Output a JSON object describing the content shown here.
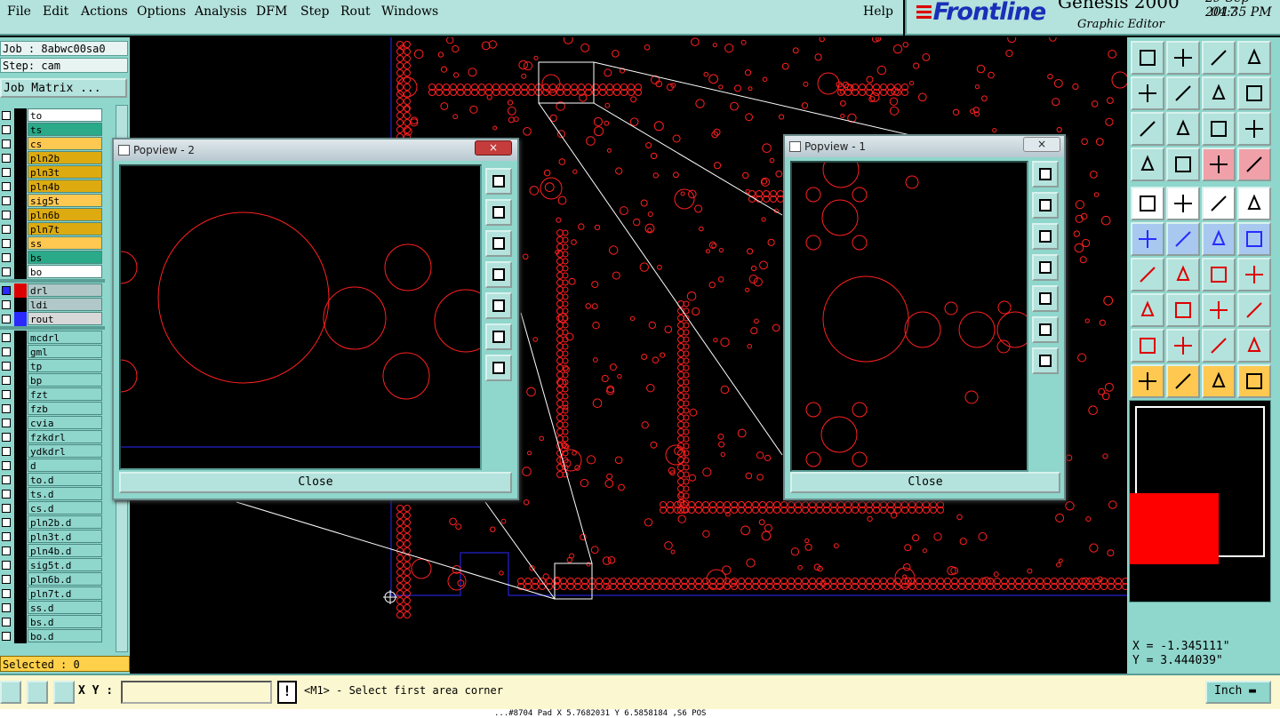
{
  "menubar": {
    "items": [
      "File",
      "Edit",
      "Actions",
      "Options",
      "Analysis",
      "DFM",
      "Step",
      "Rout",
      "Windows"
    ],
    "help": "Help"
  },
  "brand": {
    "logo": "Frontline",
    "product": "Genesis 2000",
    "subtitle": "Graphic Editor",
    "date": "29-Sep-2017",
    "time": "04:35 PM"
  },
  "job": {
    "job_line": "Job : 8abwc00sa0",
    "step_line": "Step: cam",
    "matrix_button": "Job Matrix ..."
  },
  "layers": [
    {
      "name": "to",
      "color": "#ffffff"
    },
    {
      "name": "ts",
      "color": "#2aaa88"
    },
    {
      "name": "cs",
      "color": "#ffc850"
    },
    {
      "name": "pln2b",
      "color": "#ddaa10"
    },
    {
      "name": "pln3t",
      "color": "#ddaa10"
    },
    {
      "name": "pln4b",
      "color": "#ddaa10"
    },
    {
      "name": "sig5t",
      "color": "#ffc850"
    },
    {
      "name": "pln6b",
      "color": "#ddaa10"
    },
    {
      "name": "pln7t",
      "color": "#ddaa10"
    },
    {
      "name": "ss",
      "color": "#ffc850"
    },
    {
      "name": "bs",
      "color": "#2aaa88"
    },
    {
      "name": "bo",
      "color": "#ffffff"
    },
    {
      "name": "drl",
      "color": "#b0c8c8"
    },
    {
      "name": "ldi",
      "color": "#b0c8c8"
    },
    {
      "name": "rout",
      "color": "#d8d8d8"
    },
    {
      "name": "mcdrl",
      "color": "#8fd6cc"
    },
    {
      "name": "gml",
      "color": "#8fd6cc"
    },
    {
      "name": "tp",
      "color": "#8fd6cc"
    },
    {
      "name": "bp",
      "color": "#8fd6cc"
    },
    {
      "name": "fzt",
      "color": "#8fd6cc"
    },
    {
      "name": "fzb",
      "color": "#8fd6cc"
    },
    {
      "name": "cvia",
      "color": "#8fd6cc"
    },
    {
      "name": "fzkdrl",
      "color": "#8fd6cc"
    },
    {
      "name": "ydkdrl",
      "color": "#8fd6cc"
    },
    {
      "name": "d",
      "color": "#8fd6cc"
    },
    {
      "name": "to.d",
      "color": "#8fd6cc"
    },
    {
      "name": "ts.d",
      "color": "#8fd6cc"
    },
    {
      "name": "cs.d",
      "color": "#8fd6cc"
    },
    {
      "name": "pln2b.d",
      "color": "#8fd6cc"
    },
    {
      "name": "pln3t.d",
      "color": "#8fd6cc"
    },
    {
      "name": "pln4b.d",
      "color": "#8fd6cc"
    },
    {
      "name": "sig5t.d",
      "color": "#8fd6cc"
    },
    {
      "name": "pln6b.d",
      "color": "#8fd6cc"
    },
    {
      "name": "pln7t.d",
      "color": "#8fd6cc"
    },
    {
      "name": "ss.d",
      "color": "#8fd6cc"
    },
    {
      "name": "bs.d",
      "color": "#8fd6cc"
    },
    {
      "name": "bo.d",
      "color": "#8fd6cc"
    }
  ],
  "selected": "Selected : 0",
  "popview2": {
    "title": "Popview - 2",
    "close": "Close",
    "x": "×"
  },
  "popview1": {
    "title": "Popview - 1",
    "close": "Close",
    "x": "×"
  },
  "coords": {
    "x": "X = -1.345111\"",
    "y": "Y = 3.444039\""
  },
  "bottom": {
    "xy_label": "X Y :",
    "xy_value": "",
    "prompt": "<M1> - Select first area corner",
    "unit": "Inch ▬"
  },
  "statusline": "...#8704 Pad X 5.7682031 Y 6.5858184 ,S6 POS",
  "colors": {
    "accent": "#8fd6cc",
    "drawing": "#ff2020",
    "highlight": "#ff0000",
    "board_outline": "#2a2aff"
  }
}
